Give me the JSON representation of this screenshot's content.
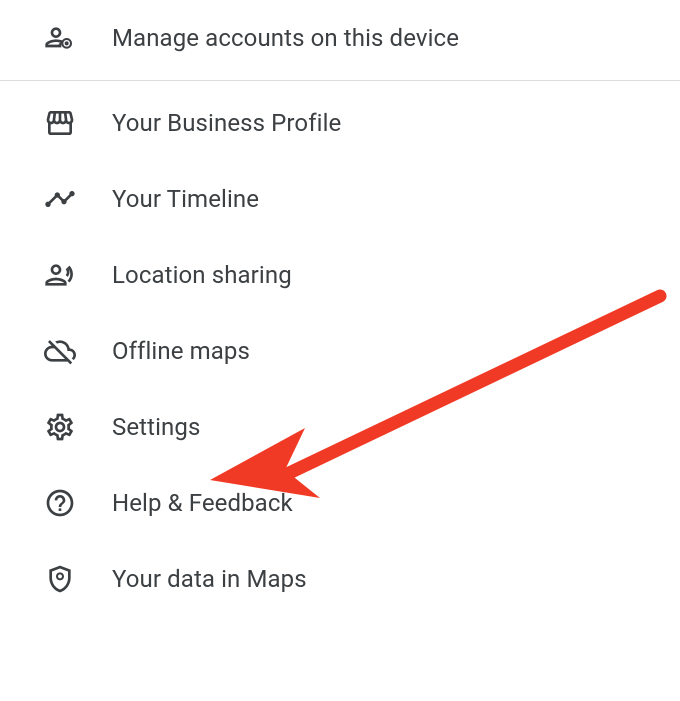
{
  "menu": {
    "items": [
      {
        "label": "Manage accounts on this device"
      },
      {
        "label": "Your Business Profile"
      },
      {
        "label": "Your Timeline"
      },
      {
        "label": "Location sharing"
      },
      {
        "label": "Offline maps"
      },
      {
        "label": "Settings"
      },
      {
        "label": "Help & Feedback"
      },
      {
        "label": "Your data in Maps"
      }
    ]
  },
  "annotation": {
    "arrow_color": "#f13a25",
    "arrow_target": "Settings"
  }
}
